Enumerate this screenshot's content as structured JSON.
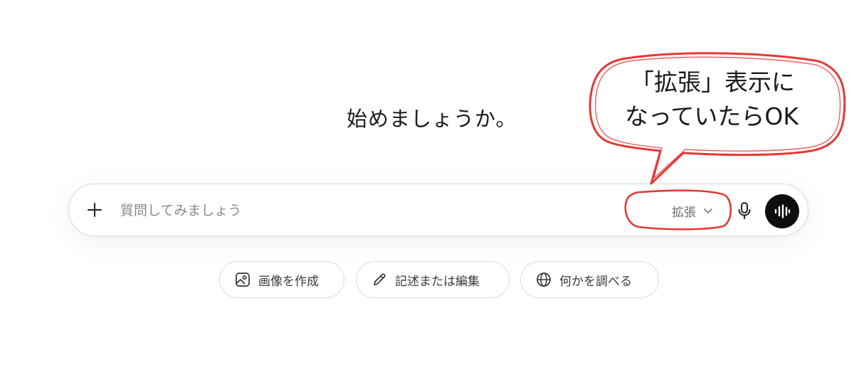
{
  "heading": "始めましょうか。",
  "composer": {
    "plus_icon": "plus-icon",
    "placeholder": "質問してみましょう",
    "mode_label": "拡張",
    "mode_chevron_icon": "chevron-down-icon",
    "mic_icon": "microphone-icon",
    "voice_icon": "voice-waveform-icon"
  },
  "chips": [
    {
      "label": "画像を作成",
      "icon": "image-icon"
    },
    {
      "label": "記述または編集",
      "icon": "pencil-icon"
    },
    {
      "label": "何かを調べる",
      "icon": "globe-icon"
    }
  ],
  "annotation": {
    "line1": "「拡張」表示に",
    "line2": "なっていたらOK",
    "color": "#e53935"
  }
}
